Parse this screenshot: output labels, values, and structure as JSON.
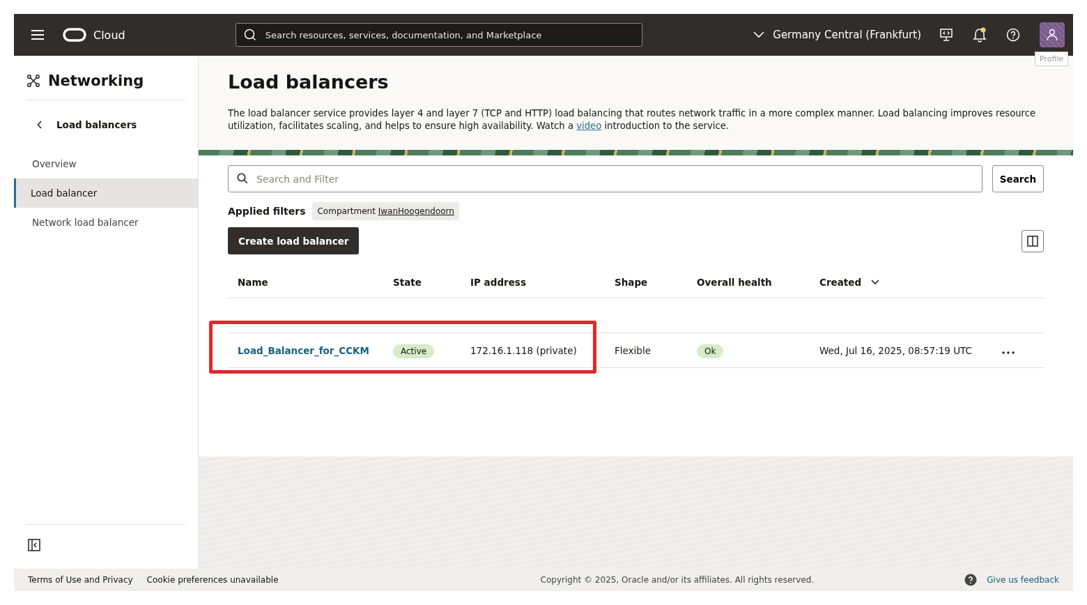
{
  "topbar": {
    "brand": "Cloud",
    "search": {
      "placeholder": "Search resources, services, documentation, and Marketplace"
    },
    "region": "Germany Central (Frankfurt)",
    "notification_unread": true,
    "profile_tooltip": "Profile"
  },
  "sidebar": {
    "title": "Networking",
    "back": "Load balancers",
    "items": [
      {
        "label": "Overview",
        "selected": false
      },
      {
        "label": "Load balancer",
        "selected": true
      },
      {
        "label": "Network load balancer",
        "selected": false
      }
    ]
  },
  "header": {
    "title": "Load balancers",
    "description_before": "The load balancer service provides layer 4 and layer 7 (TCP and HTTP) load balancing that routes network traffic in a more complex manner. Load balancing improves resource utilization, facilitates scaling, and helps to ensure high availability. Watch a",
    "link": "video",
    "description_after": "introduction to the service."
  },
  "search": {
    "placeholder": "Search and Filter",
    "button": "Search"
  },
  "filters": {
    "label": "Applied filters",
    "chips": [
      {
        "name": "Compartment",
        "value": "IwanHoogendoorn"
      }
    ]
  },
  "create_button": "Create load balancer",
  "table": {
    "columns": [
      "Name",
      "State",
      "IP address",
      "Shape",
      "Overall health",
      "Created"
    ],
    "rows": [
      {
        "name": "Load_Balancer_for_CCKM",
        "state": "Active",
        "ip": "172.16.1.118 (private)",
        "shape": "Flexible",
        "health": "Ok",
        "created": "Wed, Jul 16, 2025, 08:57:19 UTC",
        "highlighted": true
      }
    ]
  },
  "footer": {
    "terms": "Terms of Use and Privacy",
    "cookies": "Cookie preferences unavailable",
    "copyright": "Copyright © 2025, Oracle and/or its affiliates. All rights reserved.",
    "feedback": "Give us feedback"
  }
}
